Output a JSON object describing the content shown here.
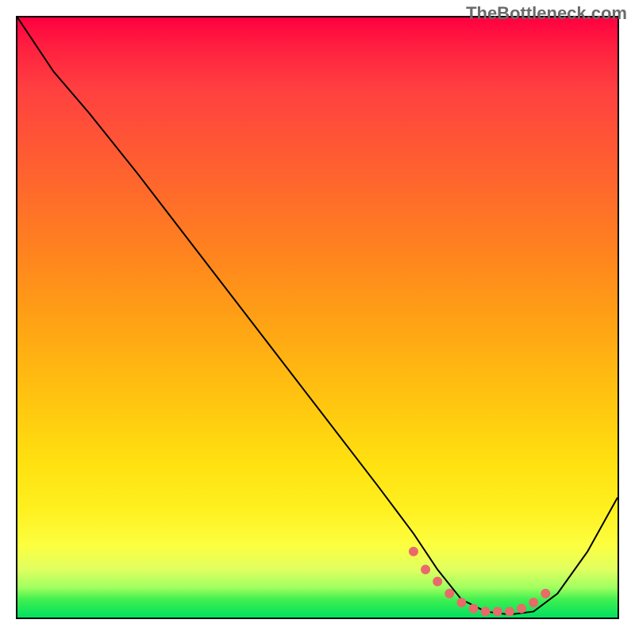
{
  "watermark": "TheBottleneck.com",
  "chart_data": {
    "type": "line",
    "title": "",
    "xlabel": "",
    "ylabel": "",
    "xlim": [
      0,
      100
    ],
    "ylim": [
      0,
      100
    ],
    "series": [
      {
        "name": "curve",
        "x": [
          0,
          6,
          12,
          20,
          30,
          40,
          50,
          60,
          66,
          70,
          74,
          78,
          82,
          86,
          90,
          95,
          100
        ],
        "y": [
          100,
          91,
          84,
          74,
          61,
          48,
          35,
          22,
          14,
          8,
          3,
          1,
          0.5,
          1,
          4,
          11,
          20
        ]
      },
      {
        "name": "highlight-dots",
        "x": [
          66,
          68,
          70,
          72,
          74,
          76,
          78,
          80,
          82,
          84,
          86,
          88
        ],
        "y": [
          11,
          8,
          6,
          4,
          2.5,
          1.5,
          1,
          1,
          1,
          1.5,
          2.5,
          4
        ]
      }
    ],
    "gradient_colors": {
      "top": "#ff0040",
      "mid_upper": "#ff8020",
      "mid": "#ffe010",
      "mid_lower": "#fcff40",
      "bottom": "#00e060"
    },
    "dot_color": "#e86a6a",
    "line_color": "#000000"
  }
}
